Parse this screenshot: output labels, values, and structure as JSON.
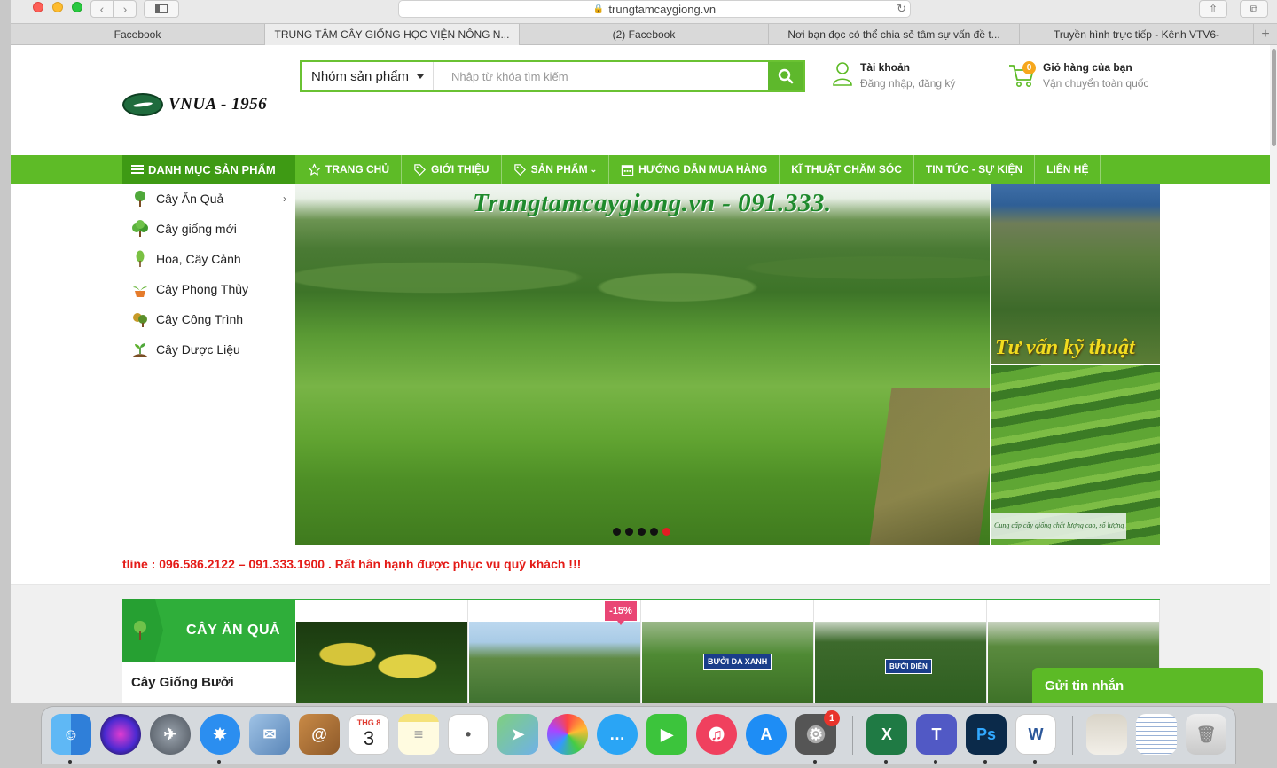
{
  "browser": {
    "url": "trungtamcaygiong.vn",
    "tabs": [
      {
        "label": "Facebook",
        "active": false
      },
      {
        "label": "TRUNG TÂM CÂY GIỐNG HỌC VIỆN NÔNG N...",
        "active": true
      },
      {
        "label": "(2) Facebook",
        "active": false
      },
      {
        "label": "Nơi bạn đọc có thể chia sẻ tâm sự vấn đề t...",
        "active": false
      },
      {
        "label": "Truyền hình trực tiếp - Kênh VTV6-",
        "active": false
      }
    ]
  },
  "header": {
    "logo_text": "VNUA - 1956",
    "search": {
      "category_label": "Nhóm sản phẩm",
      "placeholder": "Nhập từ khóa tìm kiếm"
    },
    "account": {
      "title": "Tài khoản",
      "subtitle": "Đăng nhập, đăng ký"
    },
    "cart": {
      "title": "Giỏ hàng của bạn",
      "subtitle": "Vận chuyển toàn quốc",
      "count": "0"
    }
  },
  "nav": {
    "category_button": "DANH MỤC SẢN PHẨM",
    "items": [
      {
        "label": "TRANG CHỦ",
        "icon": "star-icon"
      },
      {
        "label": "GIỚI THIỆU",
        "icon": "tag-icon"
      },
      {
        "label": "SẢN PHẨM",
        "icon": "tag-icon"
      },
      {
        "label": "HƯỚNG DẪN MUA HÀNG",
        "icon": "calendar-icon"
      },
      {
        "label": "KĨ THUẬT CHĂM SÓC",
        "icon": ""
      },
      {
        "label": "TIN TỨC - SỰ KIỆN",
        "icon": ""
      },
      {
        "label": "LIÊN HỆ",
        "icon": ""
      }
    ]
  },
  "categories": [
    {
      "label": "Cây Ăn Quả",
      "has_submenu": true
    },
    {
      "label": "Cây giống mới",
      "has_submenu": false
    },
    {
      "label": "Hoa, Cây Cảnh",
      "has_submenu": false
    },
    {
      "label": "Cây Phong Thủy",
      "has_submenu": false
    },
    {
      "label": "Cây Công Trình",
      "has_submenu": false
    },
    {
      "label": "Cây Dược Liệu",
      "has_submenu": false
    }
  ],
  "slider": {
    "caption": "Trungtamcaygiong.vn - 091.333.",
    "slide_count": 5,
    "active_slide": 5
  },
  "side_banners": {
    "top_caption": "Tư vấn kỹ thuật",
    "bottom_caption": "Cung cấp cây giống chất lượng cao, số lượng lớn"
  },
  "hotline": "tline : 096.586.2122 – 091.333.1900 . Rất hân hạnh được phục vụ quý khách !!!",
  "section": {
    "title": "CÂY ĂN QUẢ",
    "subcategory": "Cây Giống Bưởi",
    "products": [
      {
        "sale": "",
        "sign": ""
      },
      {
        "sale": "-15%",
        "sign": ""
      },
      {
        "sale": "",
        "sign": "BƯỞI DA XANH"
      },
      {
        "sale": "",
        "sign": "BƯỞI DIỄN"
      },
      {
        "sale": "",
        "sign": ""
      }
    ]
  },
  "chat": {
    "label": "Gửi tin nhắn"
  },
  "dock": {
    "calendar_month": "THG 8",
    "calendar_day": "3",
    "settings_badge": "1"
  },
  "colors": {
    "brand_green": "#5ebb27",
    "dark_green": "#3e9a14",
    "hotline_red": "#e41b17",
    "sale_pink": "#e94675"
  }
}
